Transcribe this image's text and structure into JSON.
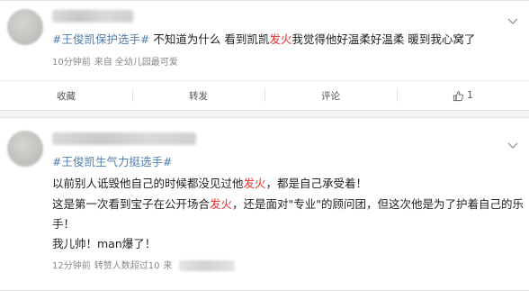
{
  "post1": {
    "hashtag": "#王俊凯保护选手#",
    "text_before": " 不知道为什么 看到凯凯",
    "text_red": "发火",
    "text_after": "我觉得他好温柔好温柔 暖到我心窝了",
    "time": "10分钟前",
    "source": "来自 全幼儿园最可爱",
    "actions": {
      "favorite": "收藏",
      "repost": "转发",
      "comment": "评论",
      "like_count": "1"
    }
  },
  "post2": {
    "hashtag": "#王俊凯生气力挺选手#",
    "line1_a": "以前别人诋毁他自己的时候都没见过他",
    "line1_red": "发火",
    "line1_b": "，都是自己承受着！",
    "line2_a": "这是第一次看到宝子在公开场合",
    "line2_red": "发火",
    "line2_b": "，还是面对\"专业\"的顾问团，但这次他是为了护着自己的乐",
    "line3": "手！",
    "line4": "我儿帅！man爆了！",
    "time": "12分钟前",
    "meta_text": "转赞人数超过10",
    "meta_from": "来"
  },
  "icons": {
    "more": "chevron-down-icon",
    "like": "thumbs-up-icon"
  }
}
